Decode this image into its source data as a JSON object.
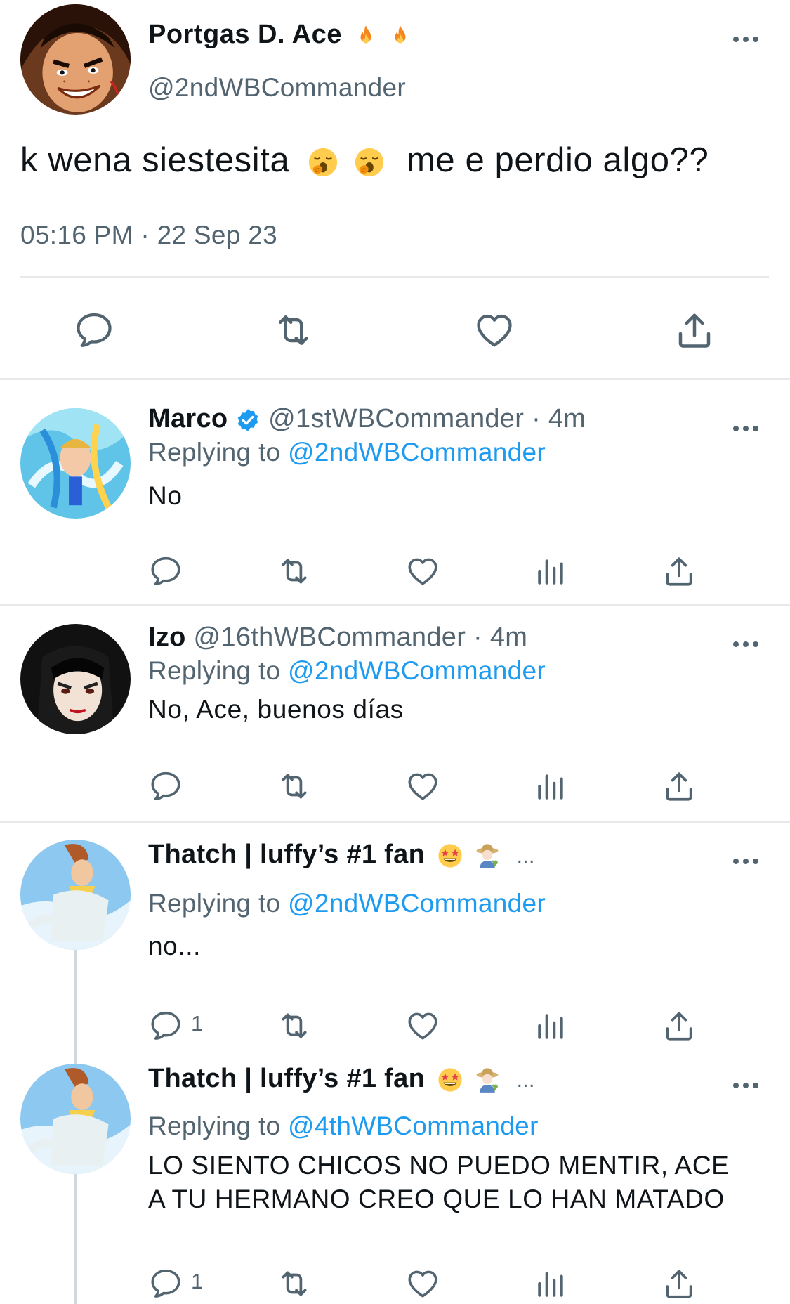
{
  "colors": {
    "link": "#1d9bf0",
    "secondary": "#536471",
    "divider": "#e7e9ea",
    "thread_line": "#cfd9de",
    "text": "#0f1419"
  },
  "main_tweet": {
    "name": "Portgas D. Ace",
    "name_emojis": [
      "fire-emoji",
      "fire-emoji"
    ],
    "handle": "@2ndWBCommander",
    "text_before": "k wena siestesita",
    "text_emojis": [
      "yawning-face-emoji",
      "yawning-face-emoji"
    ],
    "text_after": "me e perdio algo??",
    "time": "05:16 PM",
    "date": "22 Sep 23",
    "meta_separator": "·",
    "actions": [
      "reply-icon",
      "retweet-icon",
      "like-icon",
      "share-icon"
    ]
  },
  "replies": [
    {
      "name": "Marco",
      "verified": true,
      "handle": "@1stWBCommander",
      "time": "· 4m",
      "replying_label": "Replying to",
      "replying_to": "@2ndWBCommander",
      "text": "No",
      "reply_count": ""
    },
    {
      "name": "Izo",
      "verified": false,
      "handle": "@16thWBCommander",
      "time": "· 4m",
      "replying_label": "Replying to",
      "replying_to": "@2ndWBCommander",
      "text": "No, Ace, buenos días",
      "reply_count": ""
    },
    {
      "name": "Thatch | luffy’s #1 fan",
      "name_emojis": [
        "star-struck-emoji",
        "farmer-emoji"
      ],
      "truncation": "...",
      "replying_label": "Replying to",
      "replying_to": "@2ndWBCommander",
      "text": "no...",
      "reply_count": "1"
    },
    {
      "name": "Thatch | luffy’s #1 fan",
      "name_emojis": [
        "star-struck-emoji",
        "farmer-emoji"
      ],
      "truncation": "...",
      "replying_label": "Replying to",
      "replying_to": "@4thWBCommander",
      "text_line1": "LO SIENTO CHICOS NO PUEDO MENTIR, ACE",
      "text_line2": "A TU HERMANO CREO QUE LO HAN MATADO",
      "reply_count": "1"
    }
  ],
  "reply_actions": [
    "reply-icon",
    "retweet-icon",
    "like-icon",
    "views-icon",
    "share-icon"
  ]
}
